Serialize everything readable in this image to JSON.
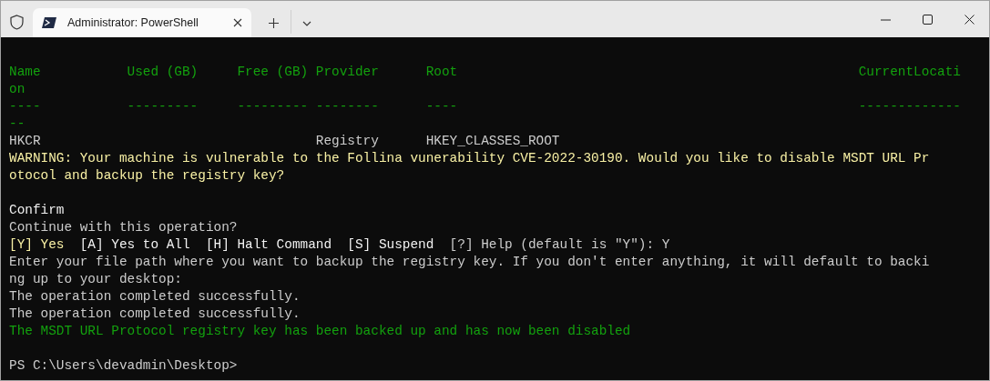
{
  "window": {
    "tab": {
      "title": "Administrator: PowerShell",
      "selected": true
    }
  },
  "terminal": {
    "lines": [
      {
        "kind": "blank"
      },
      {
        "kind": "text",
        "segments": [
          {
            "text": "Name           Used (GB)     Free (GB) Provider      Root                                                   CurrentLocati",
            "color": "#13a10e"
          }
        ]
      },
      {
        "kind": "text",
        "segments": [
          {
            "text": "on",
            "color": "#13a10e"
          }
        ]
      },
      {
        "kind": "text",
        "segments": [
          {
            "text": "----           ---------     --------- --------      ----                                                   -------------",
            "color": "#13a10e"
          }
        ]
      },
      {
        "kind": "text",
        "segments": [
          {
            "text": "--",
            "color": "#13a10e"
          }
        ]
      },
      {
        "kind": "text",
        "segments": [
          {
            "text": "HKCR                                   Registry      HKEY_CLASSES_ROOT",
            "color": "#cccccc"
          }
        ]
      },
      {
        "kind": "text",
        "segments": [
          {
            "text": "WARNING: Your machine is vulnerable to the Follina vunerability CVE-2022-30190. Would you like to disable MSDT URL Pr",
            "color": "#f9f1a5"
          }
        ]
      },
      {
        "kind": "text",
        "segments": [
          {
            "text": "otocol and backup the registry key?",
            "color": "#f9f1a5"
          }
        ]
      },
      {
        "kind": "blank"
      },
      {
        "kind": "text",
        "segments": [
          {
            "text": "Confirm",
            "color": "#f2f2f2"
          }
        ]
      },
      {
        "kind": "text",
        "segments": [
          {
            "text": "Continue with this operation?",
            "color": "#cccccc"
          }
        ]
      },
      {
        "kind": "text",
        "segments": [
          {
            "text": "[Y] Yes",
            "color": "#f9f1a5"
          },
          {
            "text": "  [A] Yes to All  [H] Halt Command  [S] Suspend",
            "color": "#f2f2f2"
          },
          {
            "text": "  [?] Help (default is \"Y\"): Y",
            "color": "#cccccc"
          }
        ]
      },
      {
        "kind": "text",
        "segments": [
          {
            "text": "Enter your file path where you want to backup the registry key. If you don't enter anything, it will default to backi",
            "color": "#cccccc"
          }
        ]
      },
      {
        "kind": "text",
        "segments": [
          {
            "text": "ng up to your desktop:",
            "color": "#cccccc"
          }
        ]
      },
      {
        "kind": "text",
        "segments": [
          {
            "text": "The operation completed successfully.",
            "color": "#cccccc"
          }
        ]
      },
      {
        "kind": "text",
        "segments": [
          {
            "text": "The operation completed successfully.",
            "color": "#cccccc"
          }
        ]
      },
      {
        "kind": "text",
        "segments": [
          {
            "text": "The MSDT URL Protocol registry key has been backed up and has now been disabled",
            "color": "#13a10e"
          }
        ]
      },
      {
        "kind": "blank"
      },
      {
        "kind": "text",
        "segments": [
          {
            "text": "PS C:\\Users\\devadmin\\Desktop>",
            "color": "#cccccc"
          }
        ]
      }
    ]
  }
}
